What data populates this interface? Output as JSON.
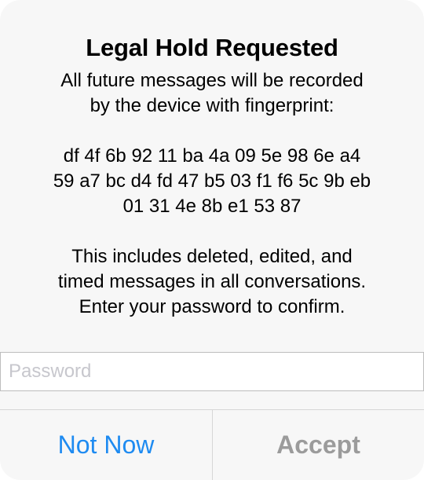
{
  "dialog": {
    "title": "Legal Hold Requested",
    "intro": "All future messages will be recorded\nby the device with fingerprint:",
    "fingerprint": "df 4f 6b 92 11 ba 4a 09 5e 98 6e a4\n59 a7 bc d4 fd 47 b5 03 f1 f6 5c 9b eb\n01 31 4e 8b e1 53 87",
    "details": "This includes deleted, edited, and\ntimed messages in all conversations.\nEnter your password to confirm.",
    "password": {
      "placeholder": "Password",
      "value": ""
    },
    "buttons": {
      "not_now": "Not Now",
      "accept": "Accept"
    }
  },
  "colors": {
    "link_blue": "#1e8bf1",
    "disabled_gray": "#9b9b9b",
    "background": "#f7f7f7"
  }
}
